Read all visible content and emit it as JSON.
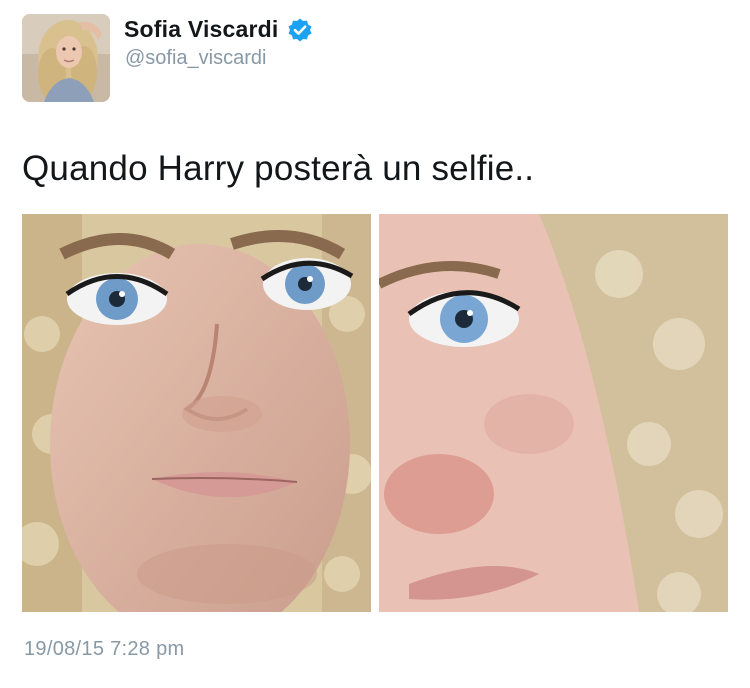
{
  "user": {
    "display_name": "Sofia Viscardi",
    "handle": "@sofia_viscardi",
    "verified": true,
    "avatar_icon": "profile-photo"
  },
  "tweet": {
    "text": "Quando Harry posterà un selfie..",
    "timestamp": "19/08/15 7:28 pm"
  },
  "media": [
    {
      "icon": "selfie-photo-wide-eyes"
    },
    {
      "icon": "selfie-photo-closeup-eye"
    }
  ],
  "colors": {
    "verified_badge": "#1da1f2",
    "secondary_text": "#8899a6",
    "primary_text": "#14171a"
  }
}
